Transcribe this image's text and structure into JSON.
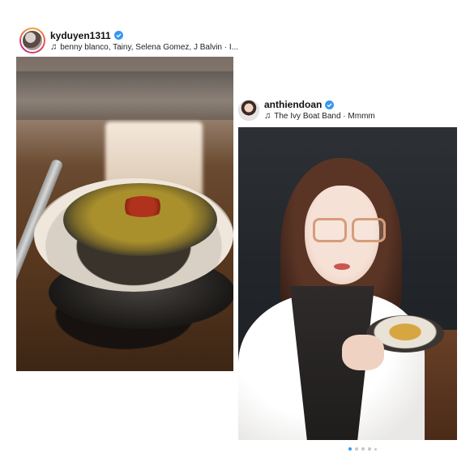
{
  "posts": [
    {
      "username": "kyduyen1311",
      "verified": true,
      "music": "benny blanco, Tainy, Selena Gomez, J Balvin · I...",
      "avatar_ring": "story-gradient"
    },
    {
      "username": "anthiendoan",
      "verified": true,
      "music": "The Ivy Boat Band · Mmmm",
      "avatar_ring": "none"
    }
  ],
  "carousel": {
    "total": 5,
    "active_index": 0
  },
  "colors": {
    "verified_badge": "#3897f0",
    "active_dot": "#3897f0",
    "inactive_dot": "#c7c7c7"
  },
  "icons": {
    "verified": "verified-badge-icon",
    "music": "music-note-icon"
  }
}
